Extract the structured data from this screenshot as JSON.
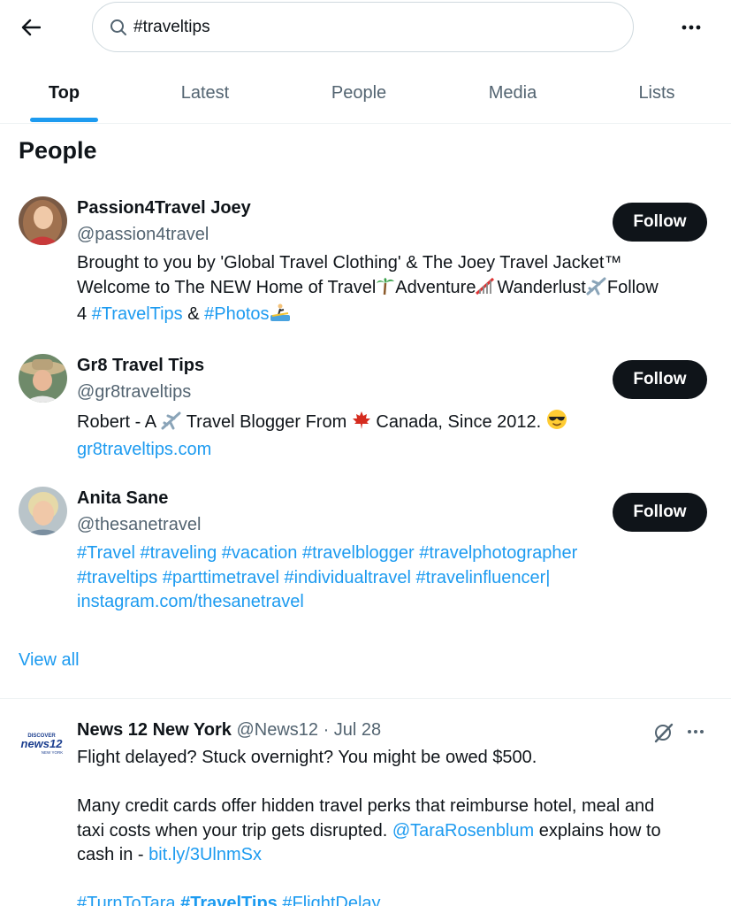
{
  "search": {
    "query": "#traveltips"
  },
  "tabs": [
    {
      "label": "Top",
      "active": true
    },
    {
      "label": "Latest",
      "active": false
    },
    {
      "label": "People",
      "active": false
    },
    {
      "label": "Media",
      "active": false
    },
    {
      "label": "Lists",
      "active": false
    }
  ],
  "people_section": {
    "title": "People",
    "view_all": "View all",
    "people": [
      {
        "name": "Passion4Travel Joey",
        "handle": "@passion4travel",
        "follow_label": "Follow",
        "bio_line1": "Brought to you by 'Global Travel Clothing' & The Joey Travel Jacket™",
        "bio_l2_a": "Welcome to The NEW Home of Travel",
        "bio_l2_b": "Adventure",
        "bio_l2_c": "Wanderlust",
        "bio_l2_d": "Follow",
        "bio_l3_a": "4",
        "bio_l3_tag1": "#TravelTips",
        "bio_l3_amp": "&",
        "bio_l3_tag2": "#Photos"
      },
      {
        "name": "Gr8 Travel Tips",
        "handle": "@gr8traveltips",
        "follow_label": "Follow",
        "bio_a": "Robert - A",
        "bio_b": "Travel Blogger From",
        "bio_c": "Canada, Since 2012.",
        "link": "gr8traveltips.com"
      },
      {
        "name": "Anita Sane",
        "handle": "@thesanetravel",
        "follow_label": "Follow",
        "tags_line1": "#Travel #traveling #vacation #travelblogger #travelphotographer",
        "tags_line2": "#traveltips #parttimetravel #individualtravel #travelinfluencer|",
        "link": "instagram.com/thesanetravel"
      }
    ]
  },
  "tweet": {
    "logo_top": "DISCOVER",
    "logo_main": "news12",
    "logo_sub": "NEW YORK",
    "name": "News 12 New York",
    "meta": "@News12 · Jul 28",
    "line1": "Flight delayed? Stuck overnight? You might be owed $500.",
    "para2_line1": "Many credit cards offer hidden travel perks that reimburse hotel, meal and",
    "para2_line2_a": "taxi costs when your trip gets disrupted.",
    "para2_mention": "@TaraRosenblum",
    "para2_line2_b": "explains how to",
    "para2_line3_a": "cash in -",
    "para2_link": "bit.ly/3UlnmSx",
    "tag1": "#TurnToTara",
    "tag2": "#TravelTips",
    "tag3": "#FlightDelay"
  },
  "colors": {
    "accent": "#1d9bf0",
    "text": "#0f1419",
    "secondary": "#536471",
    "button": "#0f1419"
  },
  "icons": [
    "back-arrow-icon",
    "search-icon",
    "more-icon",
    "palm-tree-emoji",
    "roller-coaster-emoji",
    "airplane-emoji",
    "surfer-emoji",
    "maple-leaf-emoji",
    "sunglasses-emoji",
    "grok-icon"
  ]
}
